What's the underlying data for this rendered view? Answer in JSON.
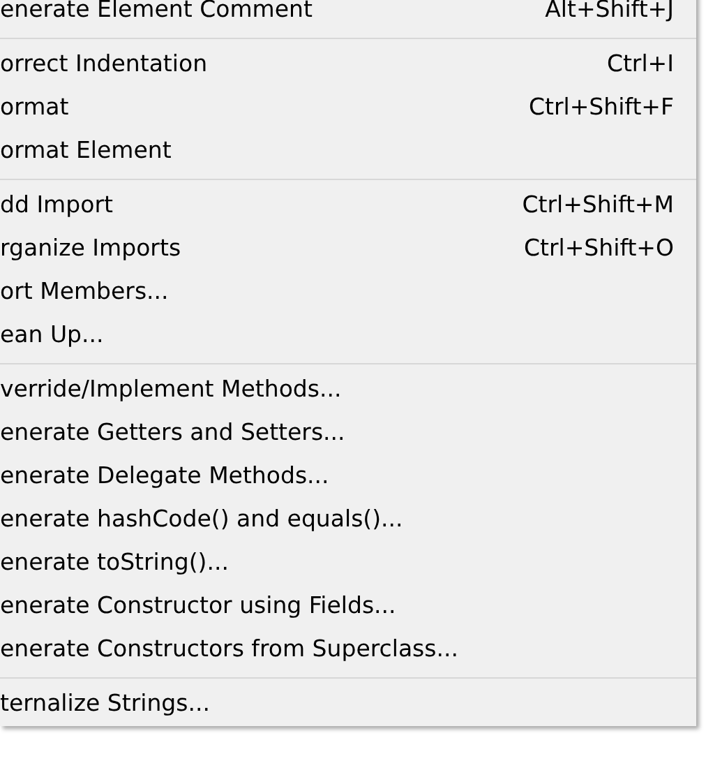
{
  "menu": {
    "groups": [
      [
        {
          "label": "enerate Element Comment",
          "shortcut": "Alt+Shift+J"
        }
      ],
      [
        {
          "label": "orrect Indentation",
          "shortcut": "Ctrl+I"
        },
        {
          "label": "ormat",
          "shortcut": "Ctrl+Shift+F"
        },
        {
          "label": "ormat Element"
        }
      ],
      [
        {
          "label": "dd Import",
          "shortcut": "Ctrl+Shift+M"
        },
        {
          "label": "rganize Imports",
          "shortcut": "Ctrl+Shift+O"
        },
        {
          "label": "ort Members..."
        },
        {
          "label": "ean Up..."
        }
      ],
      [
        {
          "label": "verride/Implement Methods..."
        },
        {
          "label": "enerate Getters and Setters..."
        },
        {
          "label": "enerate Delegate Methods..."
        },
        {
          "label": "enerate hashCode() and equals()..."
        },
        {
          "label": "enerate toString()..."
        },
        {
          "label": "enerate Constructor using Fields..."
        },
        {
          "label": "enerate Constructors from Superclass..."
        }
      ],
      [
        {
          "label": "ternalize Strings..."
        }
      ]
    ]
  }
}
